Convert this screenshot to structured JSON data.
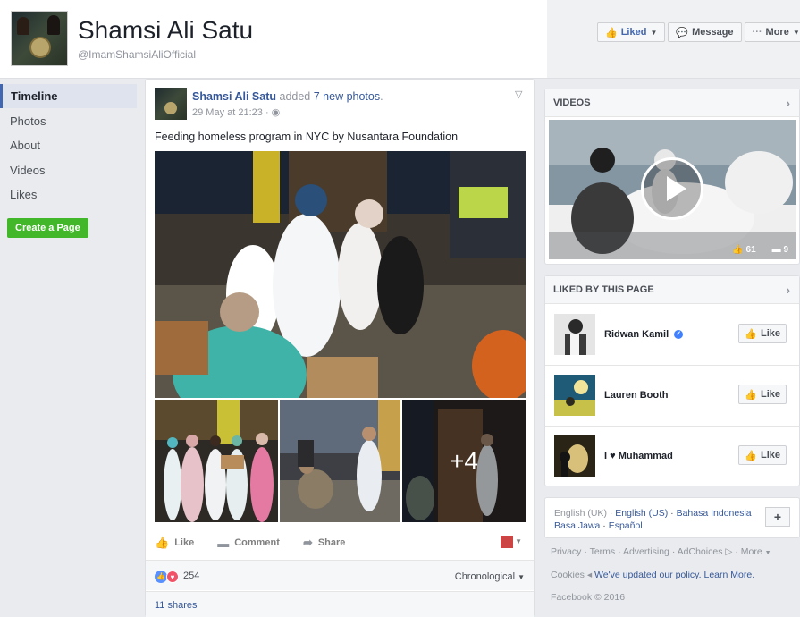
{
  "header": {
    "page_name": "Shamsi Ali Satu",
    "handle": "@ImamShamsiAliOfficial",
    "buttons": {
      "liked": "Liked",
      "message": "Message",
      "more": "More"
    }
  },
  "nav": {
    "items": [
      "Timeline",
      "Photos",
      "About",
      "Videos",
      "Likes"
    ],
    "create_page": "Create a Page"
  },
  "post": {
    "author": "Shamsi Ali Satu",
    "action": "added",
    "action_link": "7 new photos",
    "action_end": ".",
    "date": "29 May at 21:23",
    "text": "Feeding homeless program in NYC by Nusantara Foundation",
    "more_photos": "+4",
    "actions": {
      "like": "Like",
      "comment": "Comment",
      "share": "Share"
    },
    "reaction_count": "254",
    "sort": "Chronological",
    "shares": "11 shares"
  },
  "videos": {
    "title": "VIDEOS",
    "likes": "61",
    "comments": "9"
  },
  "liked_by": {
    "title": "LIKED BY THIS PAGE",
    "pages": [
      {
        "name": "Ridwan Kamil",
        "verified": true,
        "button": "Like"
      },
      {
        "name": "Lauren Booth",
        "verified": false,
        "button": "Like"
      },
      {
        "name": "I ♥ Muhammad",
        "verified": false,
        "button": "Like"
      }
    ]
  },
  "languages": {
    "current": "English (UK)",
    "others": [
      "English (US)",
      "Bahasa Indonesia",
      "Basa Jawa",
      "Español"
    ]
  },
  "footer": {
    "links": [
      "Privacy",
      "Terms",
      "Advertising",
      "AdChoices",
      "More"
    ],
    "cookies": "Cookies",
    "policy_text": "We've updated our policy.",
    "learn_more": "Learn More.",
    "copyright": "Facebook © 2016"
  },
  "colors": {
    "brand_blue": "#4267b2",
    "link_blue": "#365899",
    "create_green": "#42b72a"
  },
  "icons": [
    "thumbs-up-icon",
    "message-icon",
    "more-dots-icon",
    "chevron-down-icon",
    "globe-icon",
    "comment-icon",
    "share-icon",
    "play-icon",
    "chevron-right-icon",
    "verified-icon",
    "plus-icon"
  ]
}
